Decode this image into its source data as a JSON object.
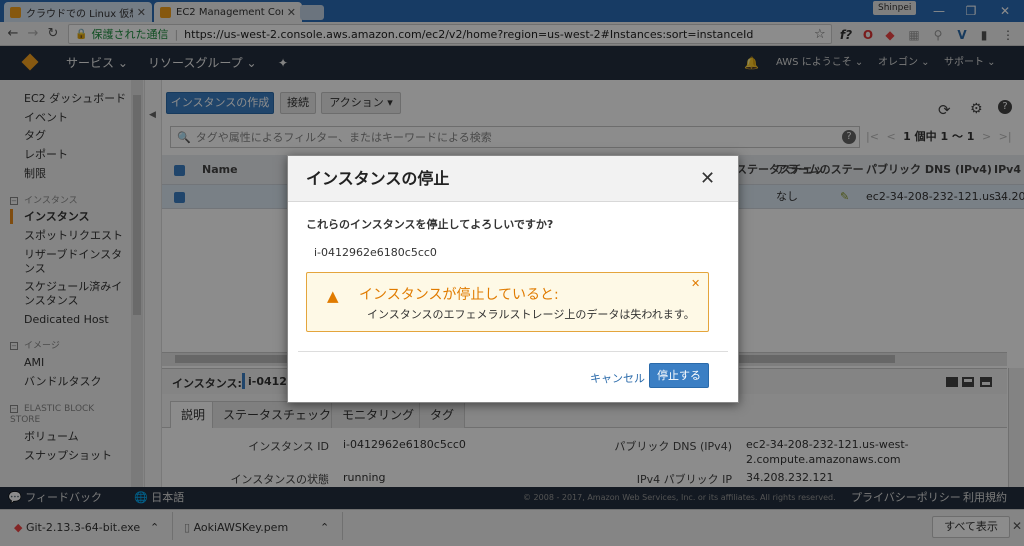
{
  "browser": {
    "tabs": [
      {
        "title": "クラウドでの Linux 仮想マシ",
        "active": false
      },
      {
        "title": "EC2 Management Conso",
        "active": true
      }
    ],
    "user": "Shinpei",
    "window_controls": {
      "minimize": "—",
      "restore": "❐",
      "close": "✕"
    },
    "address": {
      "secure_label": "保護された通信",
      "url": "https://us-west-2.console.aws.amazon.com/ec2/v2/home?region=us-west-2#Instances:sort=instanceId"
    }
  },
  "awsnav": {
    "services": "サービス",
    "resource_groups": "リソースグループ",
    "welcome": "AWS にようこそ",
    "region": "オレゴン",
    "support": "サポート"
  },
  "sidebar": {
    "dashboard": "EC2 ダッシュボード",
    "events": "イベント",
    "tags": "タグ",
    "reports": "レポート",
    "limits": "制限",
    "instances_header": "インスタンス",
    "instances": "インスタンス",
    "spot_requests": "スポットリクエスト",
    "reserved": "リザーブドインスタンス",
    "scheduled": "スケジュール済みインスタンス",
    "dedicated": "Dedicated Host",
    "images_header": "イメージ",
    "ami": "AMI",
    "bundle_tasks": "バンドルタスク",
    "ebs_header": "ELASTIC BLOCK STORE",
    "volumes": "ボリューム",
    "snapshots": "スナップショット"
  },
  "toolbar": {
    "launch": "インスタンスの作成",
    "connect": "接続",
    "actions": "アクション"
  },
  "filter": {
    "placeholder": "タグや属性によるフィルター、またはキーワードによる検索"
  },
  "pager": {
    "text": "1 個中 1 ～ 1"
  },
  "table": {
    "headers": {
      "name": "Name",
      "status_check": "ステータスチェッ",
      "alarm": "アラームのステー",
      "public_dns": "パブリック DNS (IPv4)",
      "ipv4": "IPv4"
    },
    "row": {
      "alarm": "なし",
      "public_dns": "ec2-34-208-232-121.us...",
      "ipv4": "34.20"
    }
  },
  "detail": {
    "instance_label": "インスタンス:",
    "instance_id_short": "i-04129",
    "tabs": [
      "説明",
      "ステータスチェック",
      "モニタリング",
      "タグ"
    ],
    "fields": {
      "instance_id_label": "インスタンス ID",
      "instance_id": "i-0412962e6180c5cc0",
      "state_label": "インスタンスの状態",
      "state": "running",
      "public_dns_label": "パブリック DNS (IPv4)",
      "public_dns_line1": "ec2-34-208-232-121.us-west-",
      "public_dns_line2": "2.compute.amazonaws.com",
      "ipv4_label": "IPv4 パブリック IP",
      "ipv4": "34.208.232.121"
    }
  },
  "footer": {
    "feedback": "フィードバック",
    "language": "日本語",
    "copyright": "© 2008 - 2017, Amazon Web Services, Inc. or its affiliates. All rights reserved.",
    "privacy": "プライバシーポリシー",
    "terms": "利用規約"
  },
  "downloads": {
    "items": [
      "Git-2.13.3-64-bit.exe",
      "AokiAWSKey.pem"
    ],
    "show_all": "すべて表示"
  },
  "modal": {
    "title": "インスタンスの停止",
    "question": "これらのインスタンスを停止してよろしいですか?",
    "instance_id": "i-0412962e6180c5cc0",
    "warning_title": "インスタンスが停止していると:",
    "warning_text": "インスタンスのエフェメラルストレージ上のデータは失われます。",
    "cancel": "キャンセル",
    "stop": "停止する"
  },
  "colors": {
    "accent": "#3b7fc4",
    "warning": "#e07b00",
    "nav": "#232f3e"
  }
}
